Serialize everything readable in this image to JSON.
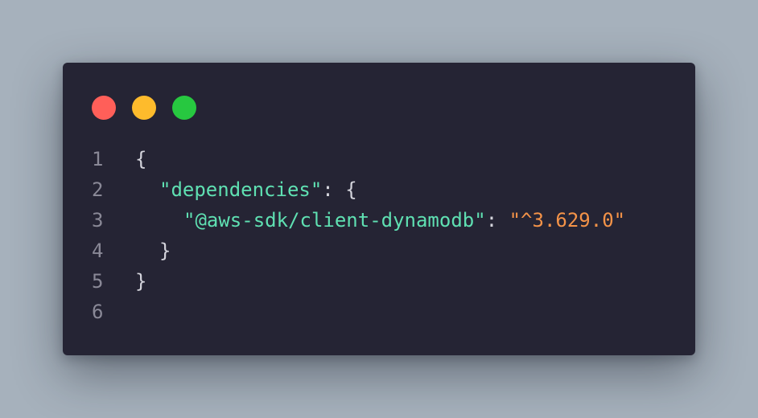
{
  "window": {
    "controls": [
      {
        "name": "close",
        "color": "#ff5f59"
      },
      {
        "name": "minimize",
        "color": "#febb2c"
      },
      {
        "name": "maximize",
        "color": "#27c840"
      }
    ]
  },
  "code": {
    "lines": [
      {
        "number": "1",
        "tokens": [
          {
            "text": "{",
            "kind": "punc"
          }
        ]
      },
      {
        "number": "2",
        "tokens": [
          {
            "text": "\"dependencies\"",
            "kind": "key"
          },
          {
            "text": ": {",
            "kind": "punc"
          }
        ]
      },
      {
        "number": "3",
        "tokens": [
          {
            "text": "\"@aws-sdk/client-dynamodb\"",
            "kind": "key"
          },
          {
            "text": ": ",
            "kind": "punc"
          },
          {
            "text": "\"^3.629.0\"",
            "kind": "str"
          }
        ]
      },
      {
        "number": "4",
        "tokens": [
          {
            "text": "}",
            "kind": "punc"
          }
        ]
      },
      {
        "number": "5",
        "tokens": [
          {
            "text": "}",
            "kind": "punc"
          }
        ]
      },
      {
        "number": "6",
        "tokens": []
      }
    ]
  }
}
